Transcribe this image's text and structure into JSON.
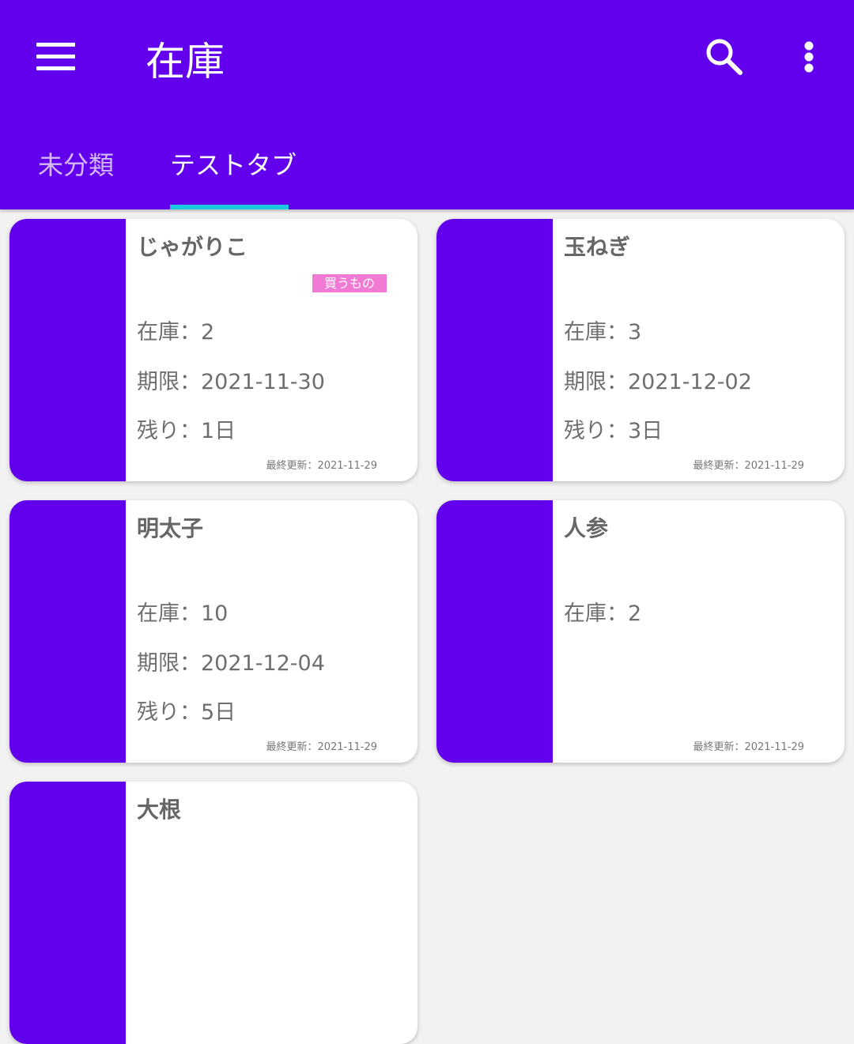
{
  "appbar": {
    "title": "在庫",
    "icons": [
      "menu-icon",
      "search-icon",
      "more-vert-icon"
    ],
    "color": "#6200ee"
  },
  "tabs": [
    {
      "label": "未分類",
      "selected": false
    },
    {
      "label": "テストタブ",
      "selected": true
    }
  ],
  "accent": "#1ac8e0",
  "badge_color": "#f07ad4",
  "cards": [
    {
      "name": "じゃがりこ",
      "badge": "買うもの",
      "stock": "在庫：2",
      "deadline": "期限：2021-11-30",
      "remaining": "残り：1日",
      "updated": "最終更新：2021-11-29"
    },
    {
      "name": "玉ねぎ",
      "stock": "在庫：3",
      "deadline": "期限：2021-12-02",
      "remaining": "残り：3日",
      "updated": "最終更新：2021-11-29"
    },
    {
      "name": "明太子",
      "stock": "在庫：10",
      "deadline": "期限：2021-12-04",
      "remaining": "残り：5日",
      "updated": "最終更新：2021-11-29"
    },
    {
      "name": "人参",
      "stock": "在庫：2",
      "updated": "最終更新：2021-11-29"
    },
    {
      "name": "大根"
    }
  ]
}
